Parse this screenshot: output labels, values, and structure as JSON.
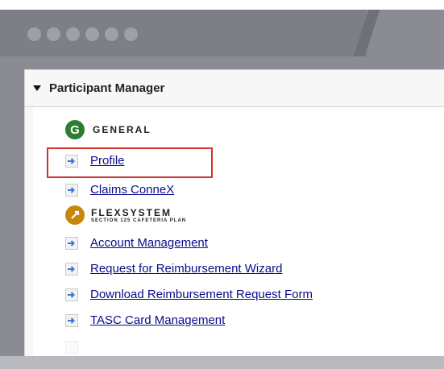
{
  "window": {
    "controls": [
      "dot",
      "dot",
      "dot",
      "dot",
      "dot",
      "dot"
    ]
  },
  "panel": {
    "title": "Participant Manager"
  },
  "general": {
    "logo_letter": "G",
    "title": "GENERAL",
    "logo_color": "#2e7d32",
    "items": [
      {
        "label": "Profile",
        "highlighted": true
      },
      {
        "label": "Claims ConneX",
        "highlighted": false
      }
    ]
  },
  "flexsystem": {
    "title": "FLEXSYSTEM",
    "subtitle": "SECTION 125 CAFETERIA PLAN",
    "logo_color": "#c8860a",
    "items": [
      {
        "label": "Account Management"
      },
      {
        "label": "Request for Reimbursement Wizard"
      },
      {
        "label": "Download Reimbursement Request Form"
      },
      {
        "label": "TASC Card Management"
      }
    ]
  },
  "colors": {
    "link": "#0b0b8c",
    "highlight": "#d0342c",
    "arrow": "#3a7bd5"
  },
  "icons": {
    "collapse": "caret-down-icon",
    "link": "arrow-right-icon"
  }
}
